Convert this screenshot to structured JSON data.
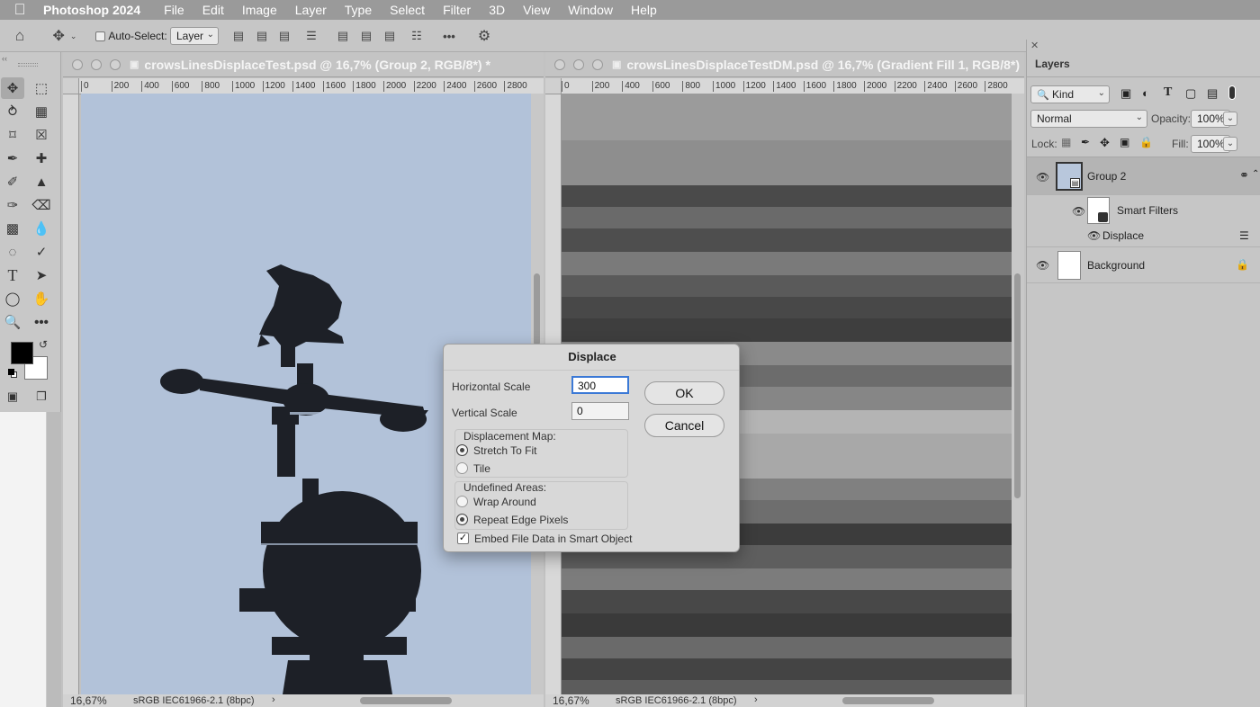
{
  "menubar": {
    "app": "Photoshop 2024",
    "items": [
      "File",
      "Edit",
      "Image",
      "Layer",
      "Type",
      "Select",
      "Filter",
      "3D",
      "View",
      "Window",
      "Help"
    ]
  },
  "options": {
    "auto_select_label": "Auto-Select:",
    "auto_select_value": "Layer"
  },
  "documents": [
    {
      "title": "crowsLinesDisplaceTest.psd @ 16,7% (Group 2, RGB/8*) *",
      "zoom": "16,67%",
      "profile": "sRGB IEC61966-2.1 (8bpc)"
    },
    {
      "title": "crowsLinesDisplaceTestDM.psd @ 16,7% (Gradient Fill 1, RGB/8*)",
      "zoom": "16,67%",
      "profile": "sRGB IEC61966-2.1 (8bpc)"
    }
  ],
  "ruler_ticks": [
    "0",
    "200",
    "400",
    "600",
    "800",
    "1000",
    "1200",
    "1400",
    "1600",
    "1800",
    "2000",
    "2200",
    "2400",
    "2600",
    "2800"
  ],
  "layers_panel": {
    "title": "Layers",
    "filter_value": "Kind",
    "blend_mode": "Normal",
    "opacity_label": "Opacity:",
    "opacity_value": "100%",
    "lock_label": "Lock:",
    "fill_label": "Fill:",
    "fill_value": "100%",
    "layers": {
      "group": "Group 2",
      "smart_filters": "Smart Filters",
      "displace": "Displace",
      "background": "Background"
    }
  },
  "dialog": {
    "title": "Displace",
    "horizontal_scale_label": "Horizontal Scale",
    "horizontal_scale_value": "300",
    "vertical_scale_label": "Vertical Scale",
    "vertical_scale_value": "0",
    "ok": "OK",
    "cancel": "Cancel",
    "displacement_map_label": "Displacement Map:",
    "stretch_label": "Stretch To Fit",
    "tile_label": "Tile",
    "undefined_label": "Undefined Areas:",
    "wrap_label": "Wrap Around",
    "repeat_label": "Repeat Edge Pixels",
    "embed_label": "Embed File Data in Smart Object",
    "stretch_checked": true,
    "repeat_checked": true,
    "embed_checked": true
  }
}
